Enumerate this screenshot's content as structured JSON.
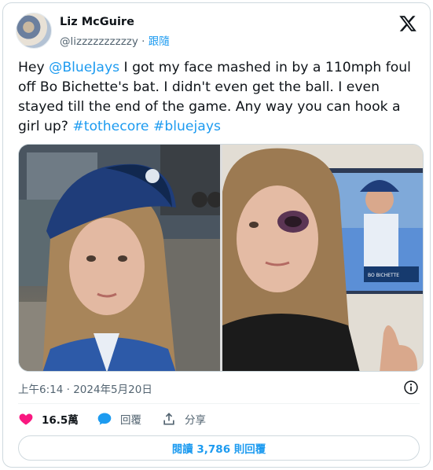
{
  "author": {
    "name": "Liz McGuire",
    "handle": "@lizzzzzzzzzzy",
    "separator": "·",
    "follow_label": "跟隨"
  },
  "tweet": {
    "part1": "Hey ",
    "mention": "@BlueJays",
    "part2": "  I got my face mashed in by a 110mph foul off Bo Bichette's bat. I didn't even get the ball. I even stayed till the end of the game. Any way you can hook a girl up? ",
    "hashtag1": "#tothecore",
    "space": " ",
    "hashtag2": "#bluejays"
  },
  "media": {
    "tv_player_name": "BO BICHETTE"
  },
  "meta": {
    "timestamp": "上午6:14 · 2024年5月20日"
  },
  "actions": {
    "likes": "16.5萬",
    "reply_label": "回覆",
    "share_label": "分享"
  },
  "read_replies": "閱讀 3,786 則回覆",
  "colors": {
    "accent": "#1d9bf0",
    "like": "#f91880",
    "muted": "#536471"
  }
}
